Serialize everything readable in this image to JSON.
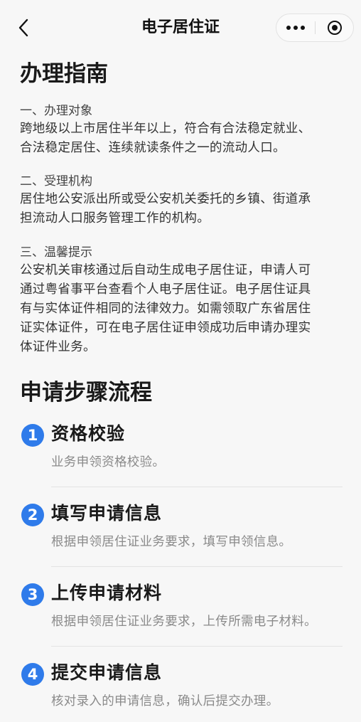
{
  "nav": {
    "title": "电子居住证",
    "back_icon": "chevron-left-icon",
    "more_icon": "more-dots-icon",
    "close_icon": "target-circle-icon"
  },
  "guide": {
    "heading": "办理指南",
    "sections": [
      {
        "title": "一、办理对象",
        "lines": [
          "跨地级以上市居住半年以上，符合有合法稳定就业、",
          "合法稳定居住、连续就读条件之一的流动人口。"
        ]
      },
      {
        "title": "二、受理机构",
        "lines": [
          "居住地公安派出所或受公安机关委托的乡镇、街道承",
          "担流动人口服务管理工作的机构。"
        ]
      },
      {
        "title": "三、温馨提示",
        "lines": [
          "公安机关审核通过后自动生成电子居住证，申请人可",
          "通过粤省事平台查看个人电子居住证。电子居住证具",
          "有与实体证件相同的法律效力。如需领取广东省居住",
          "证实体证件，可在电子居住证申领成功后申请办理实",
          "体证件业务。"
        ]
      }
    ]
  },
  "process": {
    "heading": "申请步骤流程",
    "steps": [
      {
        "num": "1",
        "title": "资格校验",
        "desc": "业务申领资格校验。"
      },
      {
        "num": "2",
        "title": "填写申请信息",
        "desc": "根据申领居住证业务要求，填写申领信息。"
      },
      {
        "num": "3",
        "title": "上传申请材料",
        "desc": "根据申领居住证业务要求，上传所需电子材料。"
      },
      {
        "num": "4",
        "title": "提交申请信息",
        "desc": "核对录入的申请信息，确认后提交办理。"
      }
    ]
  },
  "colors": {
    "accent": "#2f7bea",
    "background": "#f7f7f7"
  }
}
